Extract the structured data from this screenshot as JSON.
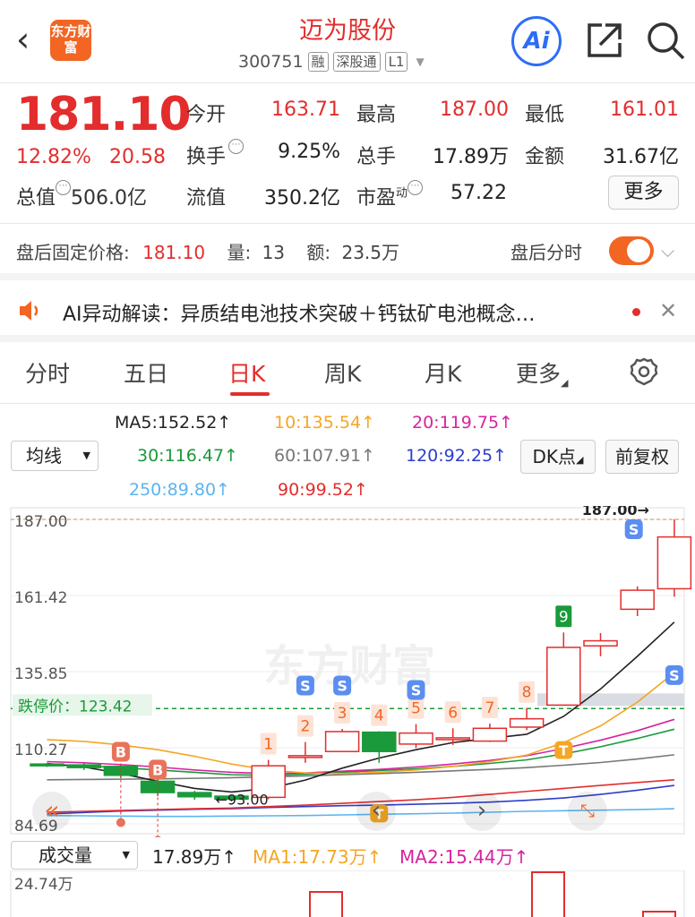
{
  "header": {
    "back_icon": "chevron-left-icon",
    "logo_text": "东方财富",
    "title": "迈为股份",
    "code": "300751",
    "tags": [
      "融",
      "深股通",
      "L1"
    ],
    "ai_label": "Ai"
  },
  "quote": {
    "price": "181.10",
    "change_pct": "12.82%",
    "change": "20.58",
    "fields": [
      {
        "label": "今开",
        "value": "163.71",
        "color": "red"
      },
      {
        "label": "最高",
        "value": "187.00",
        "color": "red"
      },
      {
        "label": "最低",
        "value": "161.01",
        "color": "red"
      },
      {
        "label": "换手",
        "value": "9.25%",
        "color": "black"
      },
      {
        "label": "总手",
        "value": "17.89万",
        "color": "black"
      },
      {
        "label": "金额",
        "value": "31.67亿",
        "color": "black"
      },
      {
        "label": "流值",
        "value": "350.2亿",
        "color": "black"
      },
      {
        "label": "市盈",
        "value": "57.22",
        "color": "black"
      }
    ],
    "cap_label": "总值",
    "cap_value": "506.0亿",
    "pe_superscript": "动",
    "more_label": "更多"
  },
  "after_hours": {
    "label": "盘后固定价格:",
    "price": "181.10",
    "vol_label": "量:",
    "vol": "13",
    "amt_label": "额:",
    "amt": "23.5万",
    "toggle_label": "盘后分时"
  },
  "ai_bar": {
    "text": "AI异动解读：异质结电池技术突破＋钙钛矿电池概念…"
  },
  "tabs": [
    "分时",
    "五日",
    "日K",
    "周K",
    "月K",
    "更多"
  ],
  "ma": {
    "select_label": "均线",
    "items": [
      {
        "text": "MA5:152.52↑",
        "color": "#222222"
      },
      {
        "text": "10:135.54↑",
        "color": "#f5a623"
      },
      {
        "text": "20:119.75↑",
        "color": "#d6249f"
      },
      {
        "text": "30:116.47↑",
        "color": "#1a9a3a"
      },
      {
        "text": "60:107.91↑",
        "color": "#777777"
      },
      {
        "text": "120:92.25↑",
        "color": "#2d3ec9"
      },
      {
        "text": "250:89.80↑",
        "color": "#5bb4f0"
      },
      {
        "text": "90:99.52↑",
        "color": "#e32d2d"
      }
    ],
    "dk_label": "DK点",
    "fq_label": "前复权"
  },
  "chart_data": {
    "type": "candlestick",
    "y_ticks": [
      "187.00",
      "161.42",
      "135.85",
      "110.27",
      "84.69"
    ],
    "ylim": [
      84.69,
      187.0
    ],
    "high_label": "187.00",
    "low_label": "93.00",
    "limit_down_label": "跌停价：",
    "limit_down_value": "123.42",
    "candles": [
      {
        "o": 104.8,
        "c": 104.2,
        "h": 105.2,
        "l": 103.8
      },
      {
        "o": 104.5,
        "c": 103.6,
        "h": 105.0,
        "l": 102.8
      },
      {
        "o": 104.0,
        "c": 101.0,
        "h": 104.6,
        "l": 100.0
      },
      {
        "o": 99.0,
        "c": 95.2,
        "h": 99.8,
        "l": 94.0
      },
      {
        "o": 95.2,
        "c": 93.8,
        "h": 95.8,
        "l": 92.8
      },
      {
        "o": 94.0,
        "c": 93.0,
        "h": 94.4,
        "l": 92.2
      },
      {
        "o": 93.6,
        "c": 104.2,
        "h": 106.2,
        "l": 93.0
      },
      {
        "o": 107.3,
        "c": 107.6,
        "h": 112.2,
        "l": 105.2
      },
      {
        "o": 109.0,
        "c": 115.7,
        "h": 116.6,
        "l": 109.0
      },
      {
        "o": 115.5,
        "c": 109.0,
        "h": 115.8,
        "l": 105.2
      },
      {
        "o": 111.5,
        "c": 115.2,
        "h": 118.2,
        "l": 110.2
      },
      {
        "o": 113.3,
        "c": 113.6,
        "h": 116.8,
        "l": 111.2
      },
      {
        "o": 112.5,
        "c": 116.8,
        "h": 118.4,
        "l": 112.2
      },
      {
        "o": 117.2,
        "c": 120.0,
        "h": 123.6,
        "l": 116.2
      },
      {
        "o": 124.6,
        "c": 144.0,
        "h": 149.0,
        "l": 124.6
      },
      {
        "o": 144.5,
        "c": 146.2,
        "h": 148.8,
        "l": 141.0
      },
      {
        "o": 156.8,
        "c": 163.2,
        "h": 164.5,
        "l": 154.5
      },
      {
        "o": 163.7,
        "c": 181.1,
        "h": 187.0,
        "l": 161.0
      }
    ],
    "candle_marks": [
      "",
      "",
      "",
      "",
      "",
      "",
      "1",
      "2",
      "3",
      "4",
      "5",
      "6",
      "7",
      "8",
      "9",
      "",
      "",
      ""
    ],
    "buy_markers": [
      "B",
      "B"
    ],
    "sell_markers": [
      "S",
      "S",
      "S",
      "S",
      "S"
    ],
    "t_markers": [
      "T",
      "T"
    ],
    "watermark": "东方财富"
  },
  "volume": {
    "select_label": "成交量",
    "total": "17.89万↑",
    "ma1": "MA1:17.73万↑",
    "ma2": "MA2:15.44万↑",
    "ma1_color": "#f5a623",
    "ma2_color": "#d6249f",
    "top_tick": "24.74万"
  }
}
